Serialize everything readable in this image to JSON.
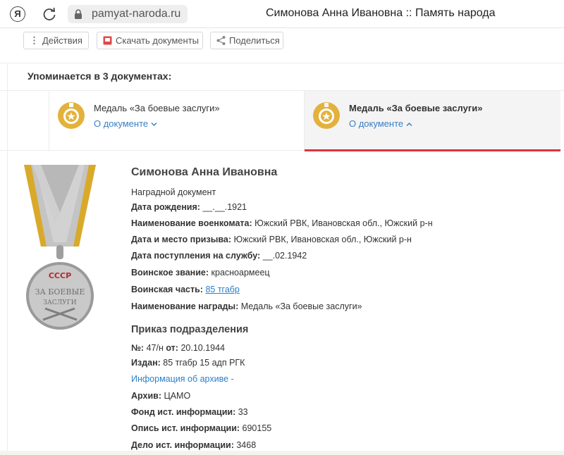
{
  "browser": {
    "logo_letter": "Я",
    "url": "pamyat-naroda.ru",
    "tab_title": "Симонова Анна Ивановна :: Память народа"
  },
  "toolbar": {
    "actions_label": "Действия",
    "download_label": "Скачать документы",
    "share_label": "Поделиться"
  },
  "mentions": {
    "title": "Упоминается в 3 документах:",
    "docs": [
      {
        "name": "Медаль «За боевые заслуги»",
        "link": "О документе",
        "chevron": "chevron-down-icon"
      },
      {
        "name": "Медаль «За боевые заслуги»",
        "link": "О документе",
        "chevron": "chevron-up-icon"
      }
    ]
  },
  "record": {
    "name": "Симонова Анна Ивановна",
    "doc_type": "Наградной документ",
    "fields": [
      {
        "label": "Дата рождения:",
        "value": "__.__.1921"
      },
      {
        "label": "Наименование военкомата:",
        "value": "Южский РВК, Ивановская обл., Южский р-н"
      },
      {
        "label": "Дата и место призыва:",
        "value": "Южский РВК, Ивановская обл., Южский р-н"
      },
      {
        "label": "Дата поступления на службу:",
        "value": "__.02.1942"
      },
      {
        "label": "Воинское звание:",
        "value": "красноармеец"
      },
      {
        "label": "Воинская часть:",
        "value": "85 тгабр"
      },
      {
        "label": "Наименование награды:",
        "value": "Медаль «За боевые заслуги»"
      }
    ]
  },
  "order": {
    "title": "Приказ подразделения",
    "number_label": "№:",
    "number_value": "47/н",
    "from_label": "от:",
    "from_value": "20.10.1944",
    "issued_label": "Издан:",
    "issued_value": "85 тгабр 15 адп РГК",
    "archive_link": "Информация об архиве",
    "archive_fields": [
      {
        "label": "Архив:",
        "value": "ЦАМО"
      },
      {
        "label": "Фонд ист. информации:",
        "value": "33"
      },
      {
        "label": "Опись ист. информации:",
        "value": "690155"
      },
      {
        "label": "Дело ист. информации:",
        "value": "3468"
      }
    ]
  },
  "medal_picture": {
    "lettering_top": "СССР",
    "lettering_mid": "ЗА БОЕВЫЕ",
    "lettering_bottom": "ЗАСЛУГИ"
  },
  "colors": {
    "link": "#2d7fc9",
    "active_underline": "#d9343e",
    "medal_gold": "#e3b23c",
    "ribbon_gray": "#bdbdbd",
    "ribbon_stripe": "#d9a92a"
  }
}
